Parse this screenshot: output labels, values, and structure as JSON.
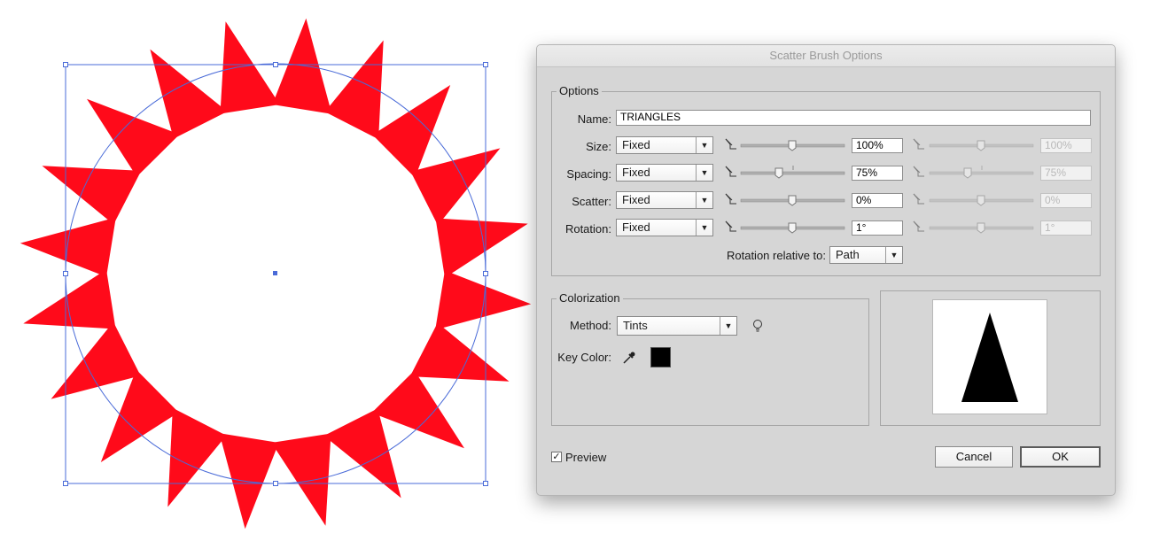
{
  "dialog": {
    "title": "Scatter Brush Options",
    "options_legend": "Options",
    "name_label": "Name:",
    "name_value": "TRIANGLES",
    "rows": [
      {
        "label": "Size:",
        "mode": "Fixed",
        "value": "100%",
        "value2": "100%"
      },
      {
        "label": "Spacing:",
        "mode": "Fixed",
        "value": "75%",
        "value2": "75%"
      },
      {
        "label": "Scatter:",
        "mode": "Fixed",
        "value": "0%",
        "value2": "0%"
      },
      {
        "label": "Rotation:",
        "mode": "Fixed",
        "value": "1°",
        "value2": "1°"
      }
    ],
    "rotation_relative_label": "Rotation relative to:",
    "rotation_relative_value": "Path",
    "colorization_legend": "Colorization",
    "method_label": "Method:",
    "method_value": "Tints",
    "key_color_label": "Key Color:",
    "key_color": "#000000",
    "preview_label": "Preview",
    "preview_checked": true,
    "cancel_label": "Cancel",
    "ok_label": "OK"
  },
  "artwork": {
    "triangle_color": "#ff0a1a",
    "selection_color": "#4a6bd8",
    "triangle_count": 20
  },
  "icons": [
    "pen-pressure-icon",
    "tip-bulb-icon",
    "eyedropper-icon",
    "dropdown-arrow-icon",
    "checkmark-icon"
  ]
}
